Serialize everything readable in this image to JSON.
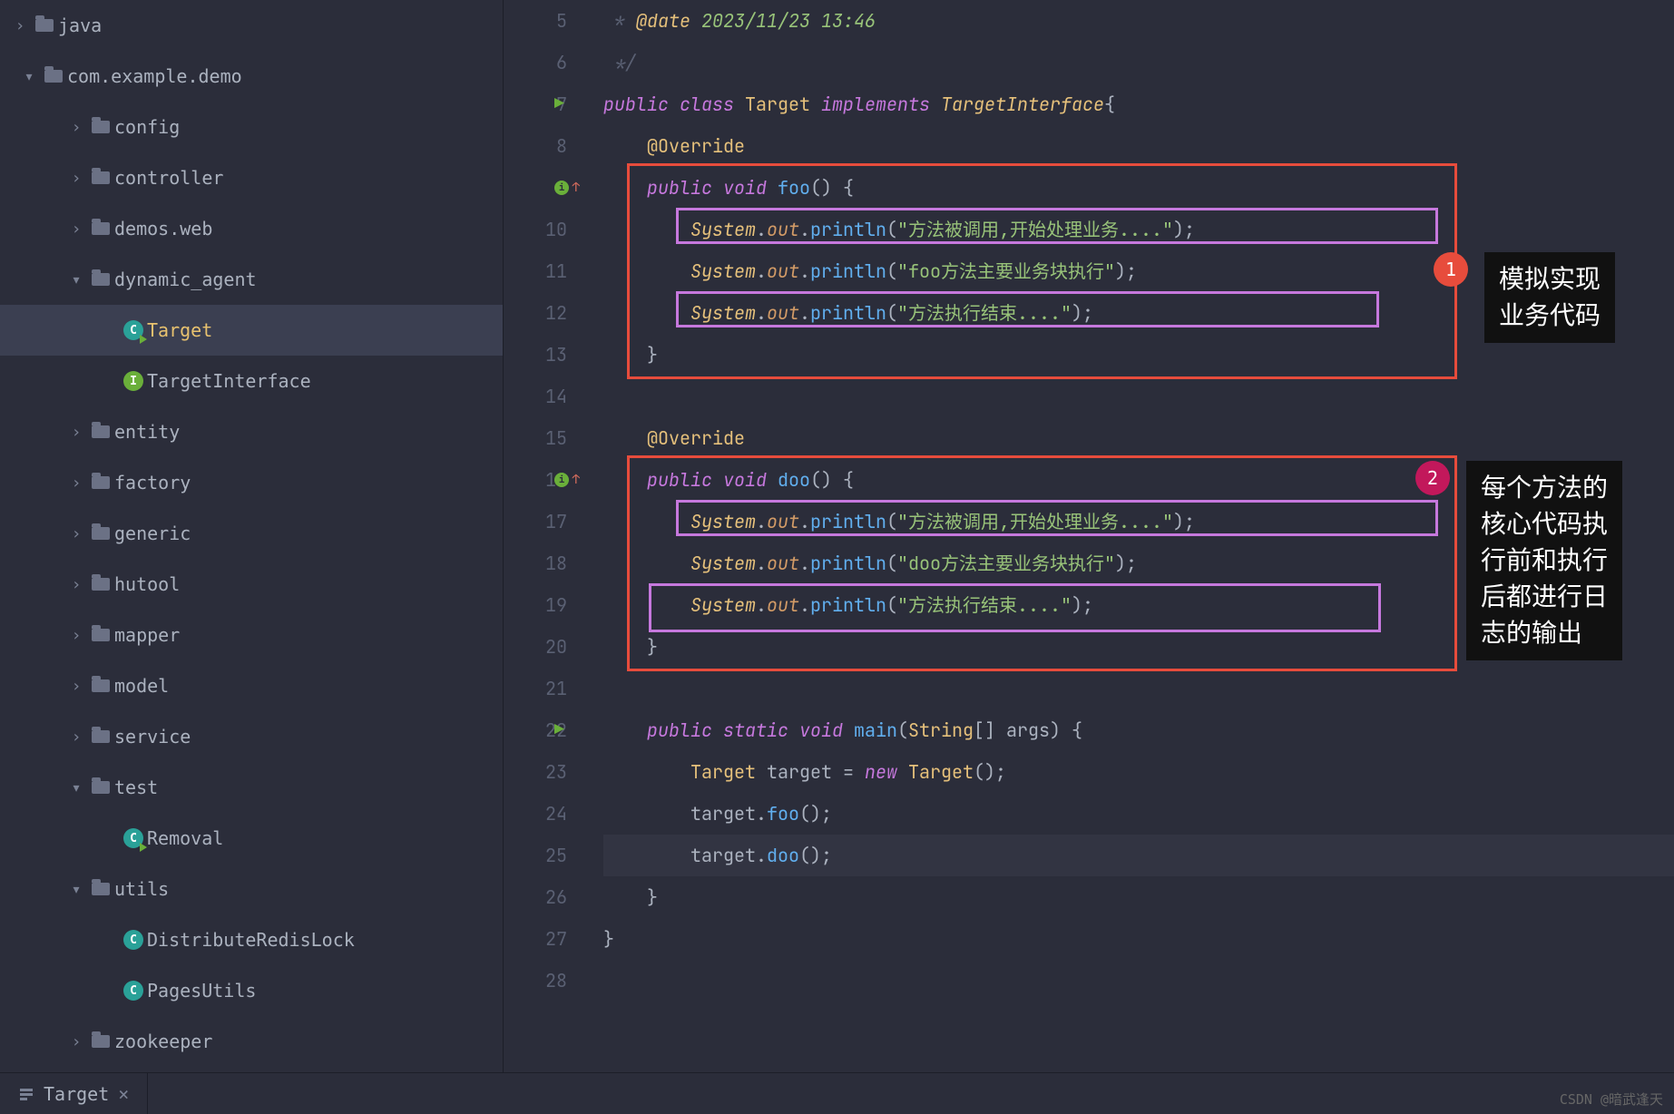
{
  "tree": {
    "root_pkg": "com.example.demo",
    "java_label": "java",
    "items": [
      {
        "label": "config",
        "type": "folder",
        "indent": 2
      },
      {
        "label": "controller",
        "type": "folder",
        "indent": 2
      },
      {
        "label": "demos.web",
        "type": "folder",
        "indent": 2
      },
      {
        "label": "dynamic_agent",
        "type": "folder",
        "indent": 2,
        "expanded": true
      },
      {
        "label": "Target",
        "type": "class-run",
        "indent": 3,
        "selected": true
      },
      {
        "label": "TargetInterface",
        "type": "interface",
        "indent": 3
      },
      {
        "label": "entity",
        "type": "folder",
        "indent": 2
      },
      {
        "label": "factory",
        "type": "folder",
        "indent": 2
      },
      {
        "label": "generic",
        "type": "folder",
        "indent": 2
      },
      {
        "label": "hutool",
        "type": "folder",
        "indent": 2
      },
      {
        "label": "mapper",
        "type": "folder",
        "indent": 2
      },
      {
        "label": "model",
        "type": "folder",
        "indent": 2
      },
      {
        "label": "service",
        "type": "folder",
        "indent": 2
      },
      {
        "label": "test",
        "type": "folder",
        "indent": 2,
        "expanded": true
      },
      {
        "label": "Removal",
        "type": "class-run",
        "indent": 3
      },
      {
        "label": "utils",
        "type": "folder",
        "indent": 2,
        "expanded": true
      },
      {
        "label": "DistributeRedisLock",
        "type": "class",
        "indent": 3
      },
      {
        "label": "PagesUtils",
        "type": "class",
        "indent": 3
      },
      {
        "label": "zookeeper",
        "type": "folder",
        "indent": 2
      }
    ]
  },
  "editor": {
    "lines": [
      {
        "n": 5,
        "parts": [
          {
            "t": " * ",
            "c": "k-comment"
          },
          {
            "t": "@date",
            "c": "k-anno k-italic"
          },
          {
            "t": " 2023/11/23 13:46",
            "c": "k-date"
          }
        ]
      },
      {
        "n": 6,
        "parts": [
          {
            "t": " */",
            "c": "k-comment"
          }
        ]
      },
      {
        "n": 7,
        "run": true,
        "parts": [
          {
            "t": "public class ",
            "c": "k-purple"
          },
          {
            "t": "Target ",
            "c": "k-yellow"
          },
          {
            "t": "implements ",
            "c": "k-purple"
          },
          {
            "t": "TargetInterface",
            "c": "k-yellow k-italic"
          },
          {
            "t": "{",
            "c": "k-gray"
          }
        ]
      },
      {
        "n": 8,
        "parts": [
          {
            "t": "    ",
            "c": ""
          },
          {
            "t": "@Override",
            "c": "k-anno"
          }
        ]
      },
      {
        "n": 9,
        "override": true,
        "parts": [
          {
            "t": "    ",
            "c": ""
          },
          {
            "t": "public void ",
            "c": "k-purple"
          },
          {
            "t": "foo",
            "c": "k-blue"
          },
          {
            "t": "() {",
            "c": "k-gray"
          }
        ]
      },
      {
        "n": 10,
        "parts": [
          {
            "t": "        ",
            "c": ""
          },
          {
            "t": "System",
            "c": "k-yellow k-italic"
          },
          {
            "t": ".",
            "c": "k-gray"
          },
          {
            "t": "out",
            "c": "k-orange k-italic"
          },
          {
            "t": ".",
            "c": "k-gray"
          },
          {
            "t": "println",
            "c": "k-blue"
          },
          {
            "t": "(",
            "c": "k-gray"
          },
          {
            "t": "\"方法被调用,开始处理业务....\"",
            "c": "k-green"
          },
          {
            "t": ");",
            "c": "k-gray"
          }
        ]
      },
      {
        "n": 11,
        "parts": [
          {
            "t": "        ",
            "c": ""
          },
          {
            "t": "System",
            "c": "k-yellow k-italic"
          },
          {
            "t": ".",
            "c": "k-gray"
          },
          {
            "t": "out",
            "c": "k-orange k-italic"
          },
          {
            "t": ".",
            "c": "k-gray"
          },
          {
            "t": "println",
            "c": "k-blue"
          },
          {
            "t": "(",
            "c": "k-gray"
          },
          {
            "t": "\"foo方法主要业务块执行\"",
            "c": "k-green"
          },
          {
            "t": ");",
            "c": "k-gray"
          }
        ]
      },
      {
        "n": 12,
        "parts": [
          {
            "t": "        ",
            "c": ""
          },
          {
            "t": "System",
            "c": "k-yellow k-italic"
          },
          {
            "t": ".",
            "c": "k-gray"
          },
          {
            "t": "out",
            "c": "k-orange k-italic"
          },
          {
            "t": ".",
            "c": "k-gray"
          },
          {
            "t": "println",
            "c": "k-blue"
          },
          {
            "t": "(",
            "c": "k-gray"
          },
          {
            "t": "\"方法执行结束....\"",
            "c": "k-green"
          },
          {
            "t": ");",
            "c": "k-gray"
          }
        ]
      },
      {
        "n": 13,
        "parts": [
          {
            "t": "    }",
            "c": "k-gray"
          }
        ]
      },
      {
        "n": 14,
        "parts": []
      },
      {
        "n": 15,
        "parts": [
          {
            "t": "    ",
            "c": ""
          },
          {
            "t": "@Override",
            "c": "k-anno"
          }
        ]
      },
      {
        "n": 16,
        "override": true,
        "parts": [
          {
            "t": "    ",
            "c": ""
          },
          {
            "t": "public void ",
            "c": "k-purple"
          },
          {
            "t": "doo",
            "c": "k-blue"
          },
          {
            "t": "() {",
            "c": "k-gray"
          }
        ]
      },
      {
        "n": 17,
        "parts": [
          {
            "t": "        ",
            "c": ""
          },
          {
            "t": "System",
            "c": "k-yellow k-italic"
          },
          {
            "t": ".",
            "c": "k-gray"
          },
          {
            "t": "out",
            "c": "k-orange k-italic"
          },
          {
            "t": ".",
            "c": "k-gray"
          },
          {
            "t": "println",
            "c": "k-blue"
          },
          {
            "t": "(",
            "c": "k-gray"
          },
          {
            "t": "\"方法被调用,开始处理业务....\"",
            "c": "k-green"
          },
          {
            "t": ");",
            "c": "k-gray"
          }
        ]
      },
      {
        "n": 18,
        "parts": [
          {
            "t": "        ",
            "c": ""
          },
          {
            "t": "System",
            "c": "k-yellow k-italic"
          },
          {
            "t": ".",
            "c": "k-gray"
          },
          {
            "t": "out",
            "c": "k-orange k-italic"
          },
          {
            "t": ".",
            "c": "k-gray"
          },
          {
            "t": "println",
            "c": "k-blue"
          },
          {
            "t": "(",
            "c": "k-gray"
          },
          {
            "t": "\"doo方法主要业务块执行\"",
            "c": "k-green"
          },
          {
            "t": ");",
            "c": "k-gray"
          }
        ]
      },
      {
        "n": 19,
        "parts": [
          {
            "t": "        ",
            "c": ""
          },
          {
            "t": "System",
            "c": "k-yellow k-italic"
          },
          {
            "t": ".",
            "c": "k-gray"
          },
          {
            "t": "out",
            "c": "k-orange k-italic"
          },
          {
            "t": ".",
            "c": "k-gray"
          },
          {
            "t": "println",
            "c": "k-blue"
          },
          {
            "t": "(",
            "c": "k-gray"
          },
          {
            "t": "\"方法执行结束....\"",
            "c": "k-green"
          },
          {
            "t": ");",
            "c": "k-gray"
          }
        ]
      },
      {
        "n": 20,
        "parts": [
          {
            "t": "    }",
            "c": "k-gray"
          }
        ]
      },
      {
        "n": 21,
        "parts": []
      },
      {
        "n": 22,
        "run": true,
        "parts": [
          {
            "t": "    ",
            "c": ""
          },
          {
            "t": "public static void ",
            "c": "k-purple"
          },
          {
            "t": "main",
            "c": "k-blue"
          },
          {
            "t": "(",
            "c": "k-gray"
          },
          {
            "t": "String",
            "c": "k-yellow"
          },
          {
            "t": "[] args) {",
            "c": "k-gray"
          }
        ]
      },
      {
        "n": 23,
        "parts": [
          {
            "t": "        ",
            "c": ""
          },
          {
            "t": "Target ",
            "c": "k-yellow"
          },
          {
            "t": "target = ",
            "c": "k-gray"
          },
          {
            "t": "new ",
            "c": "k-purple"
          },
          {
            "t": "Target",
            "c": "k-yellow"
          },
          {
            "t": "();",
            "c": "k-gray"
          }
        ]
      },
      {
        "n": 24,
        "parts": [
          {
            "t": "        target.",
            "c": "k-gray"
          },
          {
            "t": "foo",
            "c": "k-blue"
          },
          {
            "t": "();",
            "c": "k-gray"
          }
        ]
      },
      {
        "n": 25,
        "current": true,
        "parts": [
          {
            "t": "        target.",
            "c": "k-gray"
          },
          {
            "t": "doo",
            "c": "k-blue"
          },
          {
            "t": "();",
            "c": "k-gray"
          }
        ]
      },
      {
        "n": 26,
        "parts": [
          {
            "t": "    }",
            "c": "k-gray"
          }
        ]
      },
      {
        "n": 27,
        "parts": [
          {
            "t": "}",
            "c": "k-gray"
          }
        ]
      },
      {
        "n": 28,
        "parts": []
      }
    ]
  },
  "annotations": {
    "a1": {
      "num": "1",
      "text": "模拟实现\n业务代码"
    },
    "a2": {
      "num": "2",
      "text": "每个方法的\n核心代码执\n行前和执行\n后都进行日\n志的输出"
    }
  },
  "tabs": {
    "bottom": "Target"
  },
  "watermark": "CSDN @暗武逢天"
}
